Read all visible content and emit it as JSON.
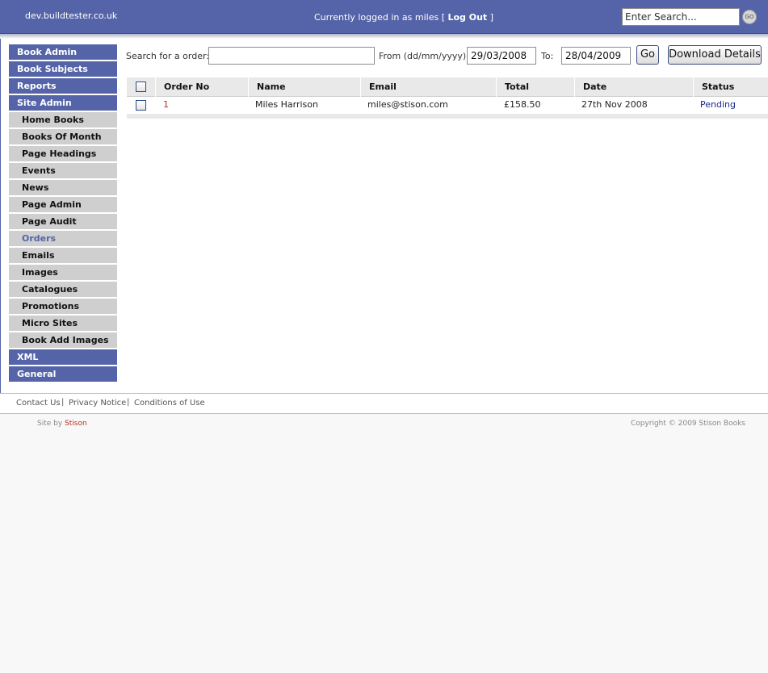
{
  "header": {
    "site_name": "dev.buildtester.co.uk",
    "login_prefix": "Currently logged in as miles [",
    "logout_label": "Log Out",
    "login_suffix": "]",
    "search_value": "Enter Search...",
    "go_label": "GO"
  },
  "nav": {
    "top_items": [
      "Book Admin",
      "Book Subjects",
      "Reports",
      "Site Admin"
    ],
    "sub_items": [
      "Home Books",
      "Books Of Month",
      "Page Headings",
      "Events",
      "News",
      "Page Admin",
      "Page Audit",
      "Orders",
      "Emails",
      "Images",
      "Catalogues",
      "Promotions",
      "Micro Sites",
      "Book Add Images"
    ],
    "active_sub": "Orders",
    "bottom_items": [
      "XML",
      "General"
    ]
  },
  "toolbar": {
    "search_label": "Search for a order:",
    "search_value": "",
    "from_label": "From (dd/mm/yyyy):",
    "from_value": "29/03/2008",
    "to_label": "To:",
    "to_value": "28/04/2009",
    "go_label": "Go",
    "download_label": "Download Details"
  },
  "table": {
    "columns": [
      "Order No",
      "Name",
      "Email",
      "Total",
      "Date",
      "Status"
    ],
    "rows": [
      {
        "order_no": "1",
        "name": "Miles Harrison",
        "email": "miles@stison.com",
        "total": "£158.50",
        "date": "27th Nov 2008",
        "status": "Pending"
      }
    ]
  },
  "footer": {
    "links": [
      "Contact Us",
      "Privacy Notice",
      "Conditions of Use"
    ],
    "separator": "|",
    "site_by_prefix": "Site by",
    "site_by_link": "Stison",
    "copyright": "Copyright © 2009 Stison Books"
  },
  "colors": {
    "brand": "#5564a8",
    "nav_sub_bg": "#cfcfcf",
    "order_link": "#b03020",
    "status_link": "#1a2a8c"
  }
}
